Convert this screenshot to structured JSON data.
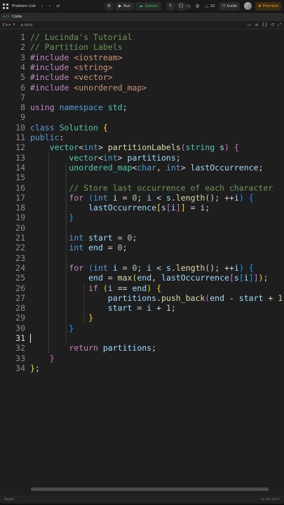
{
  "topbar": {
    "problem_list": "Problem List",
    "run": "Run",
    "submit": "Submit",
    "count": "32",
    "invite": "Invite",
    "premium": "Premium",
    "icons": [
      "grid-icon",
      "chevron-left-icon",
      "chevron-right-icon",
      "shuffle-icon",
      "debug-icon",
      "run-icon",
      "submit-icon",
      "note-icon",
      "code-brackets-icon",
      "clock-icon",
      "settings-icon",
      "fire-icon",
      "invite-icon",
      "avatar",
      "premium-icon"
    ]
  },
  "tab": {
    "label": "Code"
  },
  "toolbar": {
    "language": "C++",
    "autosave": "Auto"
  },
  "code_lines": [
    {
      "n": "1",
      "t": [
        [
          "c-com",
          "// Lucinda's Tutorial"
        ]
      ]
    },
    {
      "n": "2",
      "t": [
        [
          "c-com",
          "// Partition Labels"
        ]
      ]
    },
    {
      "n": "3",
      "t": [
        [
          "c-inc",
          "#include"
        ],
        [
          "c-txt",
          " "
        ],
        [
          "c-str",
          "<iostream>"
        ]
      ]
    },
    {
      "n": "4",
      "t": [
        [
          "c-inc",
          "#include"
        ],
        [
          "c-txt",
          " "
        ],
        [
          "c-str",
          "<string>"
        ]
      ]
    },
    {
      "n": "5",
      "t": [
        [
          "c-inc",
          "#include"
        ],
        [
          "c-txt",
          " "
        ],
        [
          "c-str",
          "<vector>"
        ]
      ]
    },
    {
      "n": "6",
      "t": [
        [
          "c-inc",
          "#include"
        ],
        [
          "c-txt",
          " "
        ],
        [
          "c-str",
          "<unordered_map>"
        ]
      ]
    },
    {
      "n": "7",
      "t": []
    },
    {
      "n": "8",
      "t": [
        [
          "c-inc",
          "using"
        ],
        [
          "c-txt",
          " "
        ],
        [
          "c-kw",
          "namespace"
        ],
        [
          "c-txt",
          " "
        ],
        [
          "c-type",
          "std"
        ],
        [
          "c-txt",
          ";"
        ]
      ]
    },
    {
      "n": "9",
      "t": []
    },
    {
      "n": "10",
      "t": [
        [
          "c-kw",
          "class"
        ],
        [
          "c-txt",
          " "
        ],
        [
          "c-type",
          "Solution"
        ],
        [
          "c-txt",
          " "
        ],
        [
          "c-br",
          "{"
        ]
      ]
    },
    {
      "n": "11",
      "t": [
        [
          "c-kw",
          "public"
        ],
        [
          "c-txt",
          ":"
        ]
      ]
    },
    {
      "n": "12",
      "t": [
        [
          "c-txt",
          "    "
        ],
        [
          "c-type",
          "vector"
        ],
        [
          "c-txt",
          "<"
        ],
        [
          "c-kw",
          "int"
        ],
        [
          "c-txt",
          "> "
        ],
        [
          "c-fn",
          "partitionLabels"
        ],
        [
          "c-br2",
          "("
        ],
        [
          "c-type",
          "string"
        ],
        [
          "c-txt",
          " "
        ],
        [
          "c-var",
          "s"
        ],
        [
          "c-br2",
          ")"
        ],
        [
          "c-txt",
          " "
        ],
        [
          "c-br2",
          "{"
        ]
      ]
    },
    {
      "n": "13",
      "t": [
        [
          "c-txt",
          "        "
        ],
        [
          "c-type",
          "vector"
        ],
        [
          "c-txt",
          "<"
        ],
        [
          "c-kw",
          "int"
        ],
        [
          "c-txt",
          "> "
        ],
        [
          "c-var",
          "partitions"
        ],
        [
          "c-txt",
          ";"
        ]
      ]
    },
    {
      "n": "14",
      "t": [
        [
          "c-txt",
          "        "
        ],
        [
          "c-type",
          "unordered_map"
        ],
        [
          "c-txt",
          "<"
        ],
        [
          "c-kw",
          "char"
        ],
        [
          "c-txt",
          ", "
        ],
        [
          "c-kw",
          "int"
        ],
        [
          "c-txt",
          "> "
        ],
        [
          "c-var",
          "lastOccurrence"
        ],
        [
          "c-txt",
          ";"
        ]
      ]
    },
    {
      "n": "15",
      "t": []
    },
    {
      "n": "16",
      "t": [
        [
          "c-txt",
          "        "
        ],
        [
          "c-com",
          "// Store last occurrence of each character"
        ]
      ]
    },
    {
      "n": "17",
      "t": [
        [
          "c-txt",
          "        "
        ],
        [
          "c-inc",
          "for"
        ],
        [
          "c-txt",
          " "
        ],
        [
          "c-br3",
          "("
        ],
        [
          "c-kw",
          "int"
        ],
        [
          "c-txt",
          " "
        ],
        [
          "c-var",
          "i"
        ],
        [
          "c-txt",
          " = "
        ],
        [
          "c-num",
          "0"
        ],
        [
          "c-txt",
          "; "
        ],
        [
          "c-var",
          "i"
        ],
        [
          "c-txt",
          " < "
        ],
        [
          "c-var",
          "s"
        ],
        [
          "c-txt",
          "."
        ],
        [
          "c-fn",
          "length"
        ],
        [
          "c-txt",
          "(); ++"
        ],
        [
          "c-var",
          "i"
        ],
        [
          "c-br3",
          ")"
        ],
        [
          "c-txt",
          " "
        ],
        [
          "c-br3",
          "{"
        ]
      ]
    },
    {
      "n": "18",
      "t": [
        [
          "c-txt",
          "            "
        ],
        [
          "c-var",
          "lastOccurrence"
        ],
        [
          "c-br",
          "["
        ],
        [
          "c-var",
          "s"
        ],
        [
          "c-br2",
          "["
        ],
        [
          "c-var",
          "i"
        ],
        [
          "c-br2",
          "]"
        ],
        [
          "c-br",
          "]"
        ],
        [
          "c-txt",
          " = "
        ],
        [
          "c-var",
          "i"
        ],
        [
          "c-txt",
          ";"
        ]
      ]
    },
    {
      "n": "19",
      "t": [
        [
          "c-txt",
          "        "
        ],
        [
          "c-br3",
          "}"
        ]
      ]
    },
    {
      "n": "20",
      "t": []
    },
    {
      "n": "21",
      "t": [
        [
          "c-txt",
          "        "
        ],
        [
          "c-kw",
          "int"
        ],
        [
          "c-txt",
          " "
        ],
        [
          "c-var",
          "start"
        ],
        [
          "c-txt",
          " = "
        ],
        [
          "c-num",
          "0"
        ],
        [
          "c-txt",
          ";"
        ]
      ]
    },
    {
      "n": "22",
      "t": [
        [
          "c-txt",
          "        "
        ],
        [
          "c-kw",
          "int"
        ],
        [
          "c-txt",
          " "
        ],
        [
          "c-var",
          "end"
        ],
        [
          "c-txt",
          " = "
        ],
        [
          "c-num",
          "0"
        ],
        [
          "c-txt",
          ";"
        ]
      ]
    },
    {
      "n": "23",
      "t": []
    },
    {
      "n": "24",
      "t": [
        [
          "c-txt",
          "        "
        ],
        [
          "c-inc",
          "for"
        ],
        [
          "c-txt",
          " "
        ],
        [
          "c-br3",
          "("
        ],
        [
          "c-kw",
          "int"
        ],
        [
          "c-txt",
          " "
        ],
        [
          "c-var",
          "i"
        ],
        [
          "c-txt",
          " = "
        ],
        [
          "c-num",
          "0"
        ],
        [
          "c-txt",
          "; "
        ],
        [
          "c-var",
          "i"
        ],
        [
          "c-txt",
          " < "
        ],
        [
          "c-var",
          "s"
        ],
        [
          "c-txt",
          "."
        ],
        [
          "c-fn",
          "length"
        ],
        [
          "c-txt",
          "(); ++"
        ],
        [
          "c-var",
          "i"
        ],
        [
          "c-br3",
          ")"
        ],
        [
          "c-txt",
          " "
        ],
        [
          "c-br3",
          "{"
        ]
      ]
    },
    {
      "n": "25",
      "t": [
        [
          "c-txt",
          "            "
        ],
        [
          "c-var",
          "end"
        ],
        [
          "c-txt",
          " = "
        ],
        [
          "c-fn",
          "max"
        ],
        [
          "c-br",
          "("
        ],
        [
          "c-var",
          "end"
        ],
        [
          "c-txt",
          ", "
        ],
        [
          "c-var",
          "lastOccurrence"
        ],
        [
          "c-br2",
          "["
        ],
        [
          "c-var",
          "s"
        ],
        [
          "c-br3",
          "["
        ],
        [
          "c-var",
          "i"
        ],
        [
          "c-br3",
          "]"
        ],
        [
          "c-br2",
          "]"
        ],
        [
          "c-br",
          ")"
        ],
        [
          "c-txt",
          ";"
        ]
      ]
    },
    {
      "n": "26",
      "t": [
        [
          "c-txt",
          "            "
        ],
        [
          "c-inc",
          "if"
        ],
        [
          "c-txt",
          " "
        ],
        [
          "c-br",
          "("
        ],
        [
          "c-var",
          "i"
        ],
        [
          "c-txt",
          " == "
        ],
        [
          "c-var",
          "end"
        ],
        [
          "c-br",
          ")"
        ],
        [
          "c-txt",
          " "
        ],
        [
          "c-br",
          "{"
        ]
      ]
    },
    {
      "n": "27",
      "t": [
        [
          "c-txt",
          "                "
        ],
        [
          "c-var",
          "partitions"
        ],
        [
          "c-txt",
          "."
        ],
        [
          "c-fn",
          "push_back"
        ],
        [
          "c-br2",
          "("
        ],
        [
          "c-var",
          "end"
        ],
        [
          "c-txt",
          " - "
        ],
        [
          "c-var",
          "start"
        ],
        [
          "c-txt",
          " + "
        ],
        [
          "c-num",
          "1"
        ],
        [
          "c-br2",
          ")"
        ],
        [
          "c-txt",
          ";"
        ]
      ]
    },
    {
      "n": "28",
      "t": [
        [
          "c-txt",
          "                "
        ],
        [
          "c-var",
          "start"
        ],
        [
          "c-txt",
          " = "
        ],
        [
          "c-var",
          "i"
        ],
        [
          "c-txt",
          " + "
        ],
        [
          "c-num",
          "1"
        ],
        [
          "c-txt",
          ";"
        ]
      ]
    },
    {
      "n": "29",
      "t": [
        [
          "c-txt",
          "            "
        ],
        [
          "c-br",
          "}"
        ]
      ]
    },
    {
      "n": "30",
      "t": [
        [
          "c-txt",
          "        "
        ],
        [
          "c-br3",
          "}"
        ]
      ]
    },
    {
      "n": "31",
      "t": []
    },
    {
      "n": "32",
      "t": [
        [
          "c-txt",
          "        "
        ],
        [
          "c-inc",
          "return"
        ],
        [
          "c-txt",
          " "
        ],
        [
          "c-var",
          "partitions"
        ],
        [
          "c-txt",
          ";"
        ]
      ]
    },
    {
      "n": "33",
      "t": [
        [
          "c-txt",
          "    "
        ],
        [
          "c-br2",
          "}"
        ]
      ]
    },
    {
      "n": "34",
      "t": [
        [
          "c-br",
          "}"
        ],
        [
          "c-txt",
          ";"
        ]
      ]
    }
  ],
  "active_line": "31",
  "status": {
    "left": "Saved",
    "right": "Ln 31, Col 1"
  }
}
